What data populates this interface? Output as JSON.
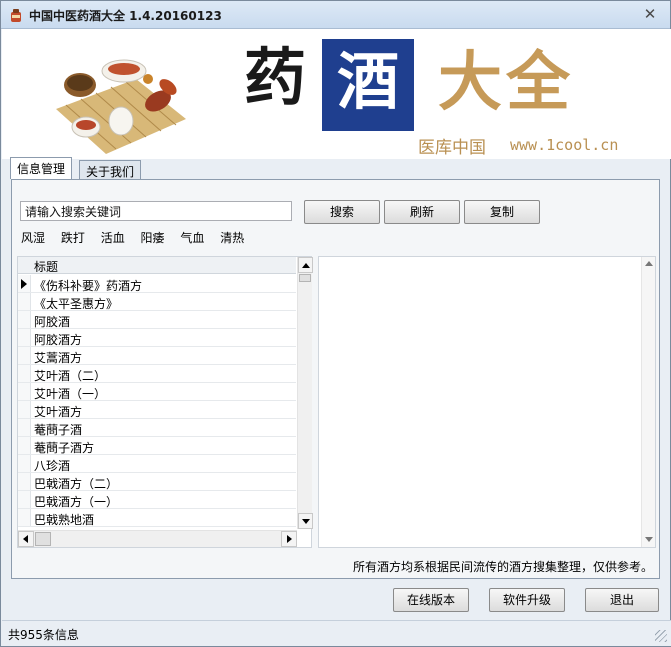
{
  "window": {
    "title": "中国中医药酒大全 1.4.20160123",
    "close_glyph": "✕"
  },
  "banner": {
    "char_yao": "药",
    "char_jiu": "酒",
    "char_daquan": "大全",
    "subtitle": "医库中国",
    "url": "www.1cool.cn"
  },
  "tabs": [
    {
      "label": "信息管理",
      "active": true
    },
    {
      "label": "关于我们",
      "active": false
    }
  ],
  "search": {
    "value": "请输入搜索关键词"
  },
  "buttons": {
    "search": "搜索",
    "refresh": "刷新",
    "copy": "复制",
    "online": "在线版本",
    "upgrade": "软件升级",
    "exit": "退出"
  },
  "categories": [
    "风湿",
    "跌打",
    "活血",
    "阳痿",
    "气血",
    "清热"
  ],
  "list": {
    "header": "标题",
    "selected_index": 0,
    "rows": [
      "《伤科补要》药酒方",
      "《太平圣惠方》",
      "阿胶酒",
      "阿胶酒方",
      "艾蒿酒方",
      "艾叶酒（二）",
      "艾叶酒（一）",
      "艾叶酒方",
      "菴蔄子酒",
      "菴蔄子酒方",
      "八珍酒",
      "巴戟酒方（二）",
      "巴戟酒方（一）",
      "巴戟熟地酒"
    ]
  },
  "footnote": "所有酒方均系根据民间流传的酒方搜集整理，仅供参考。",
  "status": {
    "text": "共955条信息"
  },
  "colors": {
    "banner_blue": "#1f3f8f",
    "banner_gold": "#c69a58"
  }
}
